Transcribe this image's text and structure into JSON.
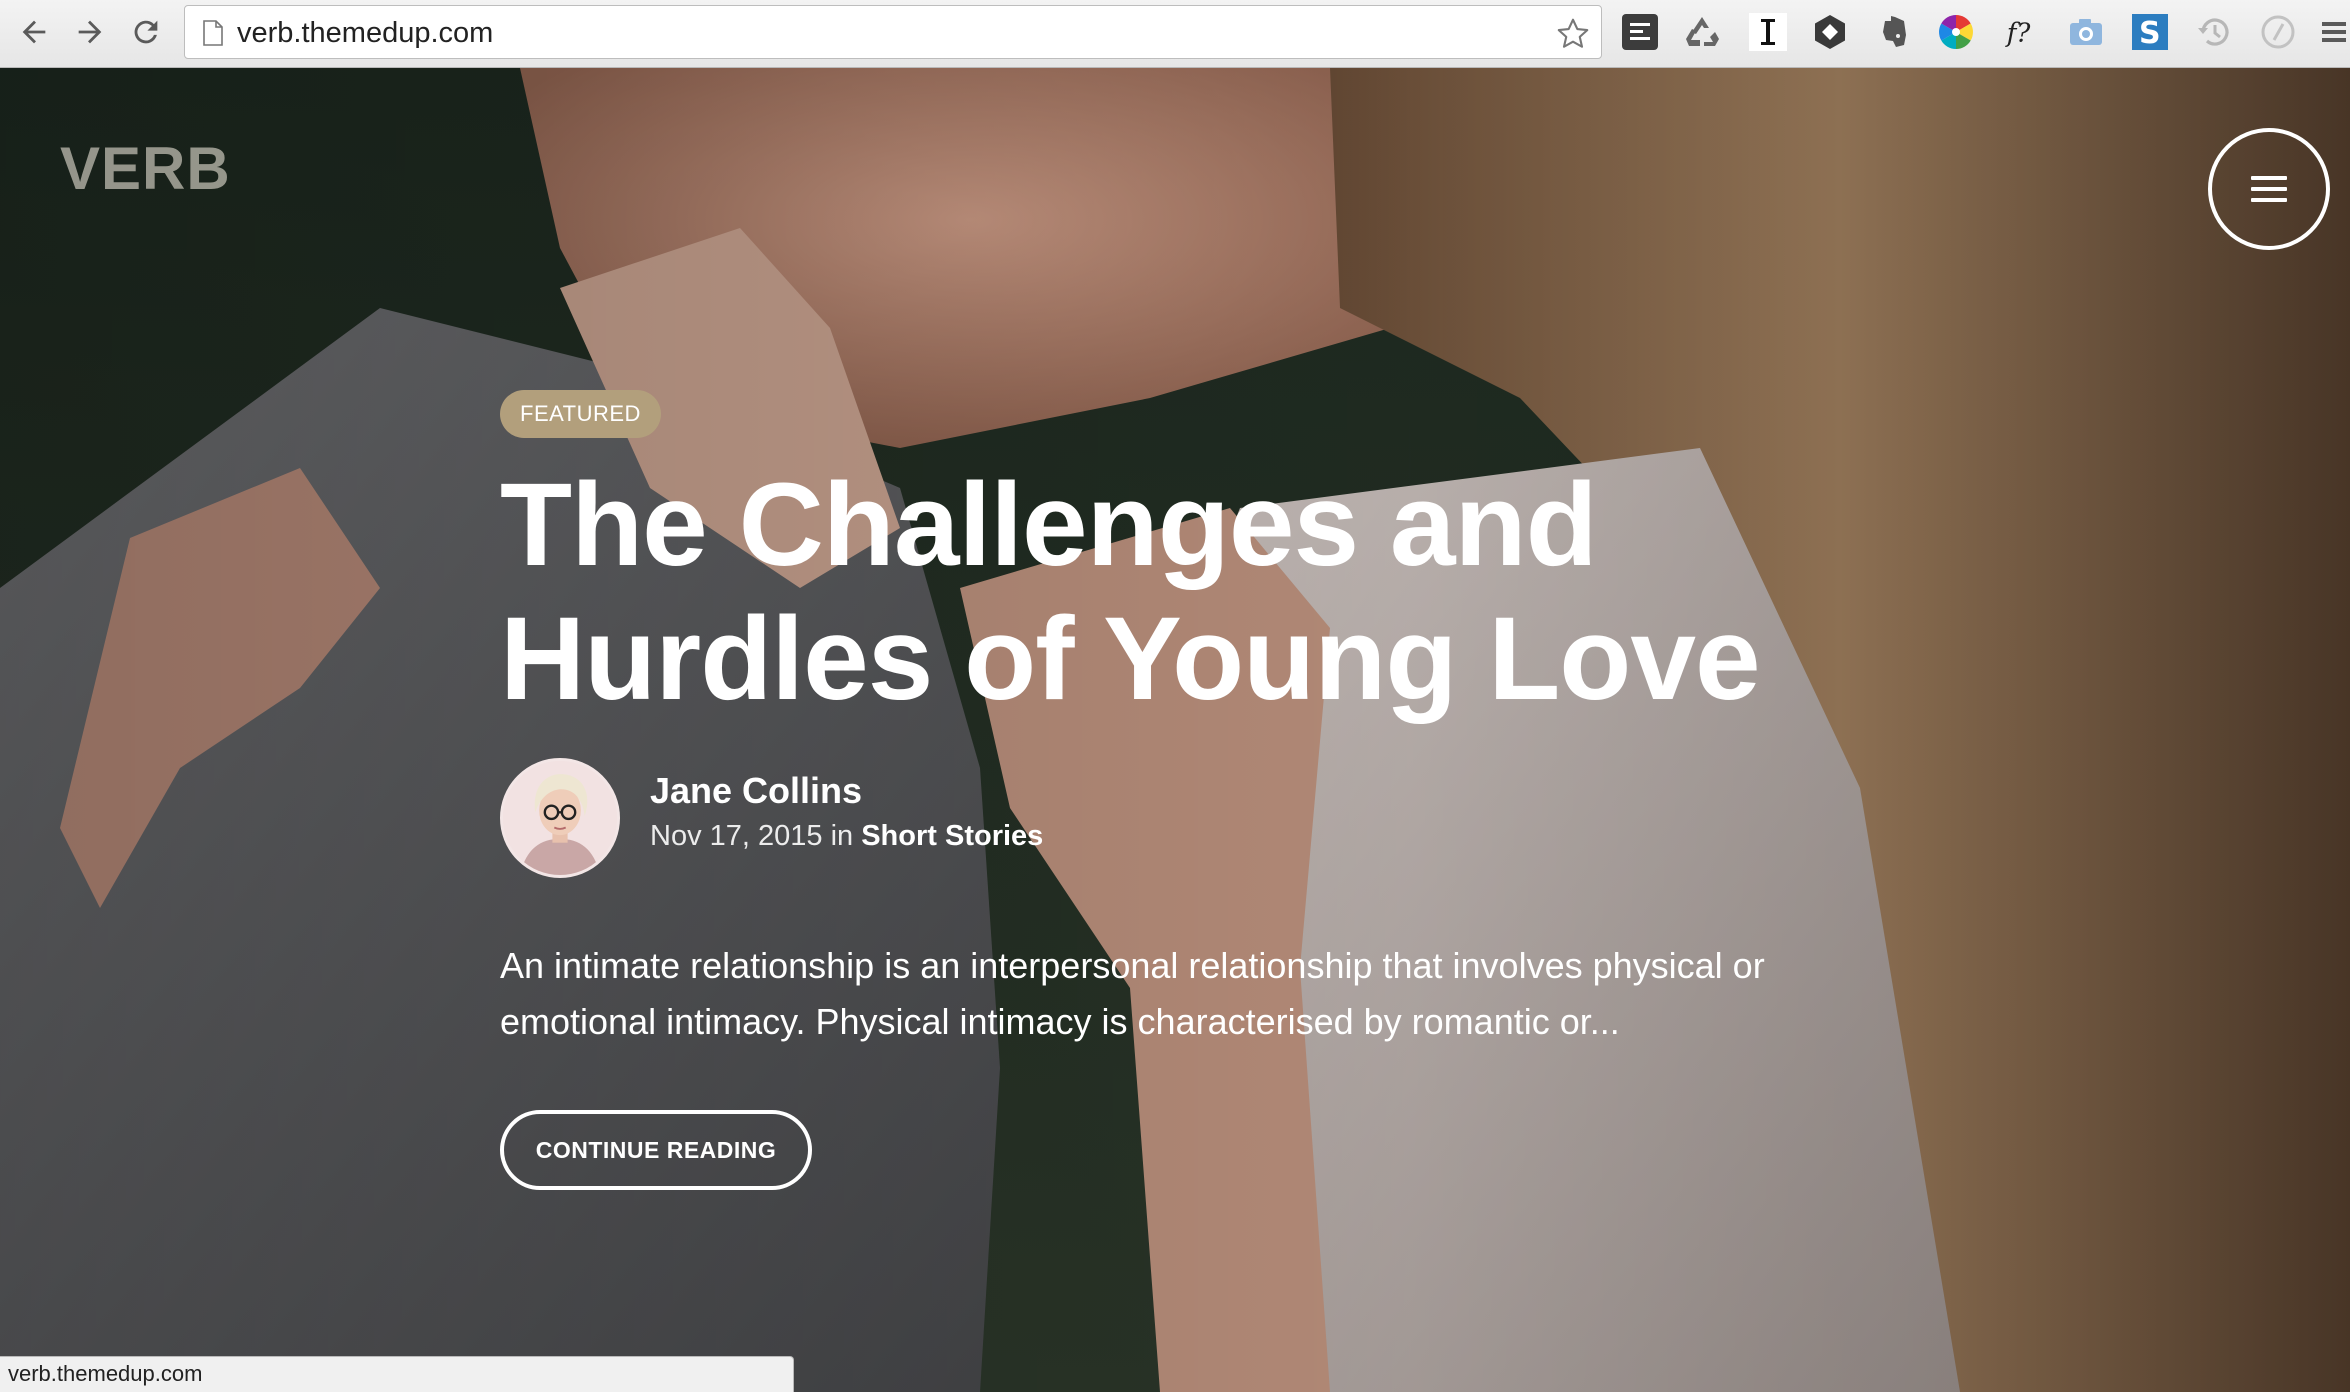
{
  "browser": {
    "url": "verb.themedup.com",
    "extensions": [
      "readability-icon",
      "recycle-icon",
      "instapaper-icon",
      "hexagon-icon",
      "evernote-icon",
      "color-wheel-icon",
      "whatfont-icon",
      "camera-icon",
      "stylebot-icon",
      "history-icon",
      "speed-dial-icon",
      "chrome-menu-icon"
    ]
  },
  "site": {
    "logo": "VERB"
  },
  "post": {
    "badge": "FEATURED",
    "title": "The Challenges and Hurdles of Young Love",
    "author": "Jane Collins",
    "date": "Nov 17, 2015",
    "in_word": "in",
    "category": "Short Stories",
    "excerpt": "An intimate relationship is an interpersonal relationship that involves physical or emotional intimacy. Physical intimacy is characterised by romantic or...",
    "cta": "CONTINUE READING"
  },
  "status_bar": {
    "text": "verb.themedup.com"
  },
  "colors": {
    "badge": "#b29f7c",
    "logo": "#b5b3a8",
    "text": "#ffffff"
  }
}
